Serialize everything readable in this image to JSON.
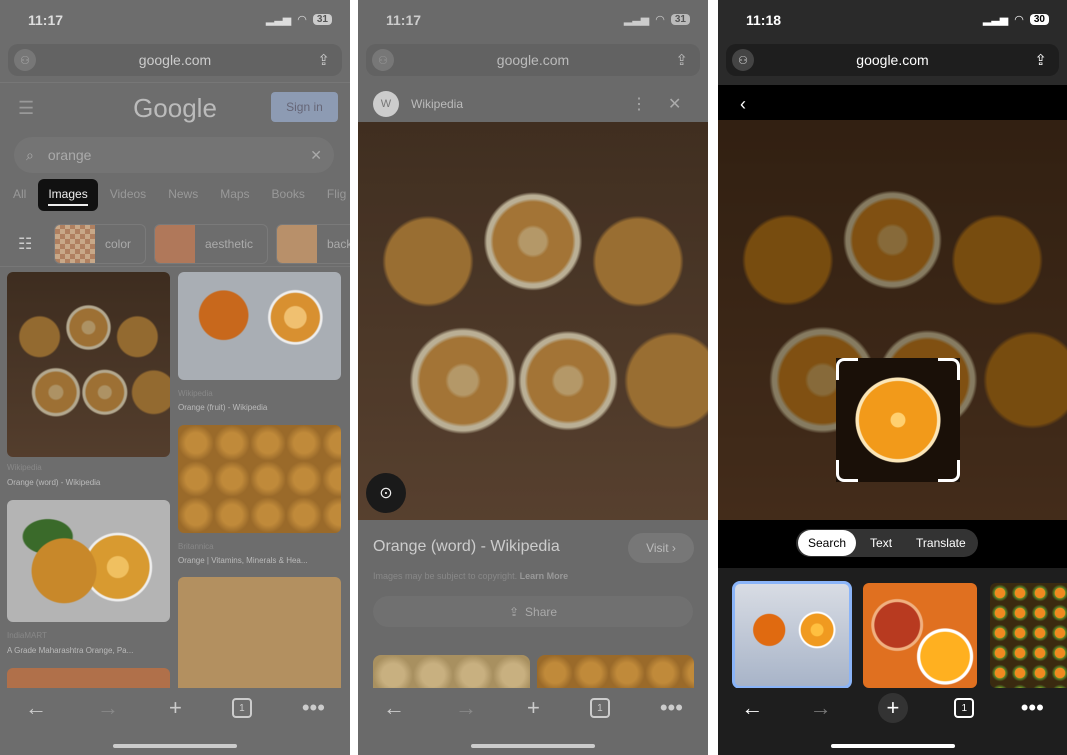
{
  "panel1": {
    "status": {
      "time": "11:17",
      "battery": "31"
    },
    "url": "google.com",
    "logo": "Google",
    "sign_in": "Sign in",
    "search_value": "orange",
    "tabs": [
      "All",
      "Images",
      "Videos",
      "News",
      "Maps",
      "Books",
      "Flig"
    ],
    "active_tab": "Images",
    "chips": [
      "color",
      "aesthetic",
      "back"
    ],
    "results": [
      {
        "source": "Wikipedia",
        "title": "Orange (word) - Wikipedia"
      },
      {
        "source": "Wikipedia",
        "title": "Orange (fruit) - Wikipedia"
      },
      {
        "source": "IndiaMART",
        "title": "A Grade Maharashtra Orange, Pa..."
      },
      {
        "source": "Britannica",
        "title": "Orange | Vitamins, Minerals & Hea..."
      }
    ],
    "tab_count": "1"
  },
  "panel2": {
    "status": {
      "time": "11:17",
      "battery": "31"
    },
    "url": "google.com",
    "source_icon": "W",
    "source": "Wikipedia",
    "title": "Orange (word) - Wikipedia",
    "visit": "Visit ›",
    "copyright": "Images may be subject to copyright.",
    "learn_more": "Learn More",
    "share": "Share",
    "tab_count": "1"
  },
  "panel3": {
    "status": {
      "time": "11:18",
      "battery": "30"
    },
    "url": "google.com",
    "modes": [
      "Search",
      "Text",
      "Translate"
    ],
    "active_mode": "Search",
    "tab_count": "1"
  },
  "colors": {
    "accent_blue": "#8ab4f8",
    "overlay_gray": "#6d6d6d"
  }
}
